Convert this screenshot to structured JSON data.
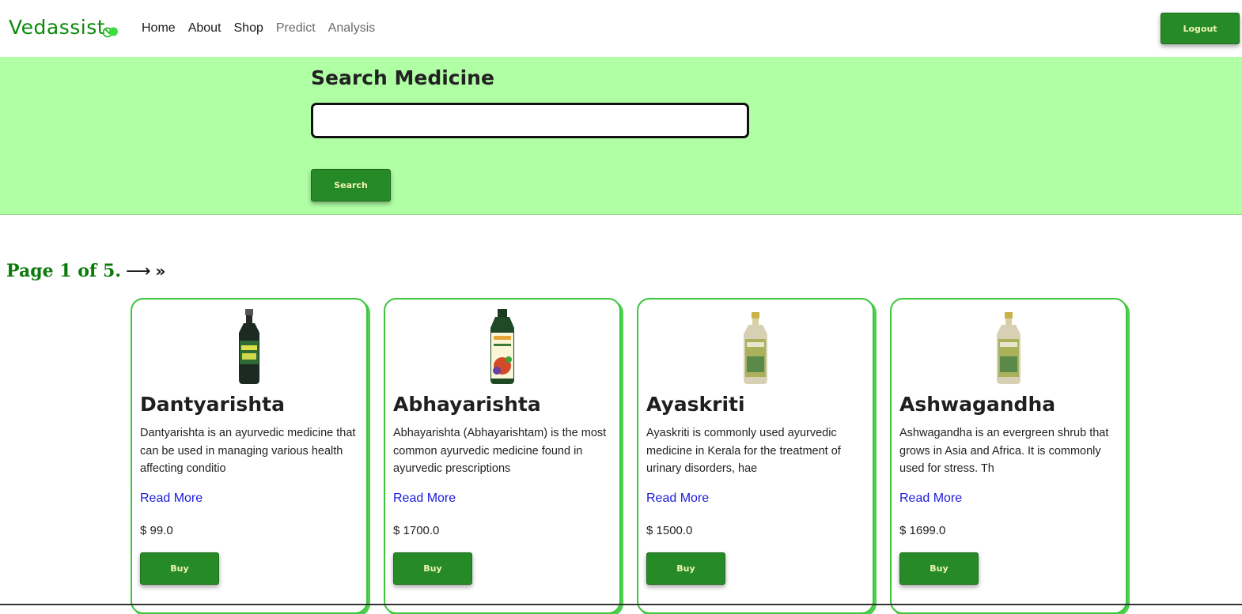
{
  "navbar": {
    "brand": "Vedassist",
    "brand_icon": "capsule-icon",
    "links": [
      {
        "label": "Home",
        "active": true
      },
      {
        "label": "About",
        "active": true
      },
      {
        "label": "Shop",
        "active": true
      },
      {
        "label": "Predict",
        "active": false
      },
      {
        "label": "Analysis",
        "active": false
      }
    ],
    "logout_label": "Logout"
  },
  "search": {
    "title": "Search Medicine",
    "input_value": "",
    "placeholder": "",
    "button_label": "Search"
  },
  "pagination": {
    "text": "Page 1 of 5.",
    "next_glyph": "⟶",
    "last_glyph": "»"
  },
  "products": [
    {
      "name": "Dantyarishta",
      "description": "Dantyarishta is an ayurvedic medicine that can be used in managing various health affecting conditio",
      "read_more": "Read More",
      "price": "$ 99.0",
      "buy_label": "Buy",
      "image": "dark-bottle-image"
    },
    {
      "name": "Abhayarishta",
      "description": "Abhayarishta (Abhayarishtam) is the most common ayurvedic medicine found in ayurvedic prescriptions",
      "read_more": "Read More",
      "price": "$ 1700.0",
      "buy_label": "Buy",
      "image": "green-bottle-image"
    },
    {
      "name": "Ayaskriti",
      "description": "Ayaskriti is commonly used ayurvedic medicine in Kerala for the treatment of urinary disorders, hae",
      "read_more": "Read More",
      "price": "$ 1500.0",
      "buy_label": "Buy",
      "image": "amber-bottle-image"
    },
    {
      "name": "Ashwagandha",
      "description": "Ashwagandha is an evergreen shrub that grows in Asia and Africa. It is commonly used for stress. Th",
      "read_more": "Read More",
      "price": "$ 1699.0",
      "buy_label": "Buy",
      "image": "amber-bottle-image"
    }
  ],
  "colors": {
    "brand": "#0b8a0b",
    "search_band": "#b0ffa5",
    "button": "#268a26",
    "button_text": "#f0f5b0",
    "card_border": "#3cc63c",
    "link": "#1a1adc"
  }
}
